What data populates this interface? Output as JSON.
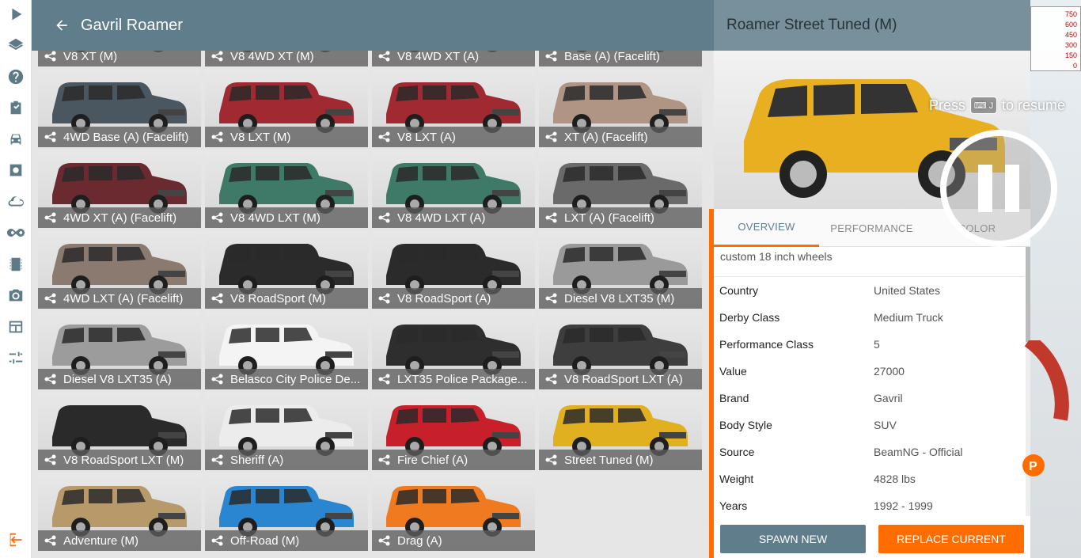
{
  "sidebar": {
    "icons": [
      "play-icon",
      "layers-icon",
      "help-icon",
      "clipboard-icon",
      "car-icon",
      "settings-icon",
      "cloud-icon",
      "infinity-icon",
      "film-icon",
      "camera-icon",
      "dashboard-icon",
      "sliders-icon",
      "exit-icon"
    ]
  },
  "header": {
    "title": "Gavril Roamer"
  },
  "grid": {
    "rows": [
      [
        "V8 XT (M)",
        "V8 4WD XT (M)",
        "V8 4WD XT (A)",
        "Base (A) (Facelift)"
      ],
      [
        "4WD Base (A) (Facelift)",
        "V8 LXT (M)",
        "V8 LXT (A)",
        "XT (A) (Facelift)"
      ],
      [
        "4WD XT (A) (Facelift)",
        "V8 4WD LXT (M)",
        "V8 4WD LXT (A)",
        "LXT (A) (Facelift)"
      ],
      [
        "4WD LXT (A) (Facelift)",
        "V8 RoadSport (M)",
        "V8 RoadSport (A)",
        "Diesel V8 LXT35 (M)"
      ],
      [
        "Diesel V8 LXT35 (A)",
        "Belasco City Police De...",
        "LXT35 Police Package...",
        "V8 RoadSport LXT (A)"
      ],
      [
        "V8 RoadSport LXT (M)",
        "Sheriff (A)",
        "Fire Chief (A)",
        "Street Tuned (M)"
      ],
      [
        "Adventure (M)",
        "Off-Road (M)",
        "Drag (A)"
      ]
    ],
    "colors": [
      [
        "#333333",
        "#3a3a3a",
        "#3a3a3a",
        "#3a3a3a"
      ],
      [
        "#4a5660",
        "#a12a32",
        "#a12a32",
        "#b09585"
      ],
      [
        "#6a2a30",
        "#3f7a68",
        "#3f7a68",
        "#6a6a6a"
      ],
      [
        "#8a7a70",
        "#2b2b2b",
        "#2b2b2b",
        "#9a9a9a"
      ],
      [
        "#9c9c9c",
        "#f4f4f4",
        "#2e2e2e",
        "#3e3e3e"
      ],
      [
        "#2a2a2a",
        "#ececec",
        "#c8202a",
        "#e0b020"
      ],
      [
        "#b89a6a",
        "#2a86d0",
        "#f07a20"
      ]
    ]
  },
  "panel": {
    "title": "Roamer Street Tuned (M)",
    "car_color": "#e8b020",
    "tabs": [
      "OVERVIEW",
      "PERFORMANCE",
      "COLOR"
    ],
    "description": "custom 18 inch wheels",
    "rows": [
      {
        "key": "Country",
        "value": "United States"
      },
      {
        "key": "Derby Class",
        "value": "Medium Truck"
      },
      {
        "key": "Performance Class",
        "value": "5"
      },
      {
        "key": "Value",
        "value": "27000"
      },
      {
        "key": "Brand",
        "value": "Gavril"
      },
      {
        "key": "Body Style",
        "value": "SUV"
      },
      {
        "key": "Source",
        "value": "BeamNG - Official"
      },
      {
        "key": "Weight",
        "value": "4828 lbs"
      },
      {
        "key": "Years",
        "value": "1992 - 1999"
      }
    ],
    "spawn_label": "SPAWN NEW",
    "replace_label": "REPLACE CURRENT"
  },
  "overlay": {
    "press": "Press",
    "key": "⌨ J",
    "to_resume": "to resume"
  },
  "graph": {
    "ticks": [
      "750",
      "600",
      "450",
      "300",
      "150",
      "0"
    ]
  },
  "colors": {
    "header": "#607d8b",
    "accent": "#ff6d00",
    "panel_header": "#78909c"
  }
}
